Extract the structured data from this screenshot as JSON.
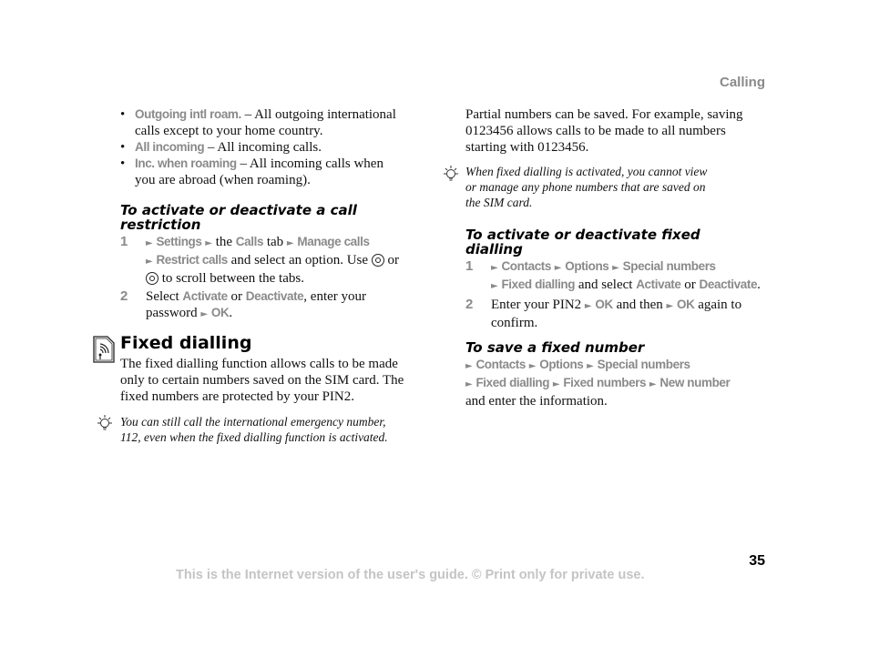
{
  "header": {
    "section": "Calling"
  },
  "left": {
    "bullets": [
      {
        "term": "Outgoing intl roam.",
        "sep": " – ",
        "text_lines": [
          "All outgoing international",
          "calls except to your home country."
        ]
      },
      {
        "term": "All incoming",
        "sep": " – ",
        "text_lines": [
          "All incoming calls."
        ]
      },
      {
        "term": "Inc. when roaming",
        "sep": " – ",
        "text_lines": [
          "All incoming calls when",
          "you are abroad (when roaming)."
        ]
      }
    ],
    "restriction_heading_lines": [
      "To activate or deactivate a call",
      "restriction"
    ],
    "restriction_steps": {
      "s1_num": "1",
      "s1_m1": "Settings",
      "s1_t1": "the",
      "s1_m2": "Calls",
      "s1_t2": "tab",
      "s1_m3": "Manage calls",
      "s1_m4": "Restrict calls",
      "s1_t3": "and select an option. Use",
      "s1_t4": "or",
      "s1_t5": "to scroll between the tabs.",
      "s2_num": "2",
      "s2_t1": "Select",
      "s2_m1": "Activate",
      "s2_t2": "or",
      "s2_m2": "Deactivate",
      "s2_t3": ", enter your",
      "s2_t4": "password",
      "s2_m3": "OK",
      "s2_t5": "."
    },
    "fixed_title": "Fixed dialling",
    "fixed_body_lines": [
      "The fixed dialling function allows calls to be made",
      "only to certain numbers saved on the SIM card. The",
      "fixed numbers are protected by your PIN2."
    ],
    "tip_lines": [
      "You can still call the international emergency number,",
      "112, even when the fixed dialling function is activated."
    ]
  },
  "right": {
    "partial_lines": [
      "Partial numbers can be saved. For example, saving",
      "0123456 allows calls to be made to all numbers",
      "starting with 0123456."
    ],
    "tip_lines": [
      "When fixed dialling is activated, you cannot view",
      "or manage any phone numbers that are saved on",
      "the SIM card."
    ],
    "fd_heading_lines": [
      "To activate or deactivate fixed",
      "dialling"
    ],
    "fd_steps": {
      "s1_num": "1",
      "s1_m1": "Contacts",
      "s1_m2": "Options",
      "s1_m3": "Special numbers",
      "s1_m4": "Fixed dialling",
      "s1_t1": "and select",
      "s1_m5": "Activate",
      "s1_t2": "or",
      "s1_m6": "Deactivate",
      "s1_t3": ".",
      "s2_num": "2",
      "s2_t1": "Enter your PIN2",
      "s2_m1": "OK",
      "s2_t2": "and then",
      "s2_m2": "OK",
      "s2_t3": "again to",
      "s2_t4": "confirm."
    },
    "save_heading": "To save a fixed number",
    "save": {
      "m1": "Contacts",
      "m2": "Options",
      "m3": "Special numbers",
      "m4": "Fixed dialling",
      "m5": "Fixed numbers",
      "m6": "New number",
      "t1": "and enter the information."
    }
  },
  "footer": {
    "page_number": "35",
    "notice": "This is the Internet version of the user's guide. © Print only for private use."
  },
  "icons": {
    "arrow": "►"
  },
  "colors": {
    "menu_gray": "#8a8a8a",
    "footer_gray": "#c4c4c4"
  }
}
